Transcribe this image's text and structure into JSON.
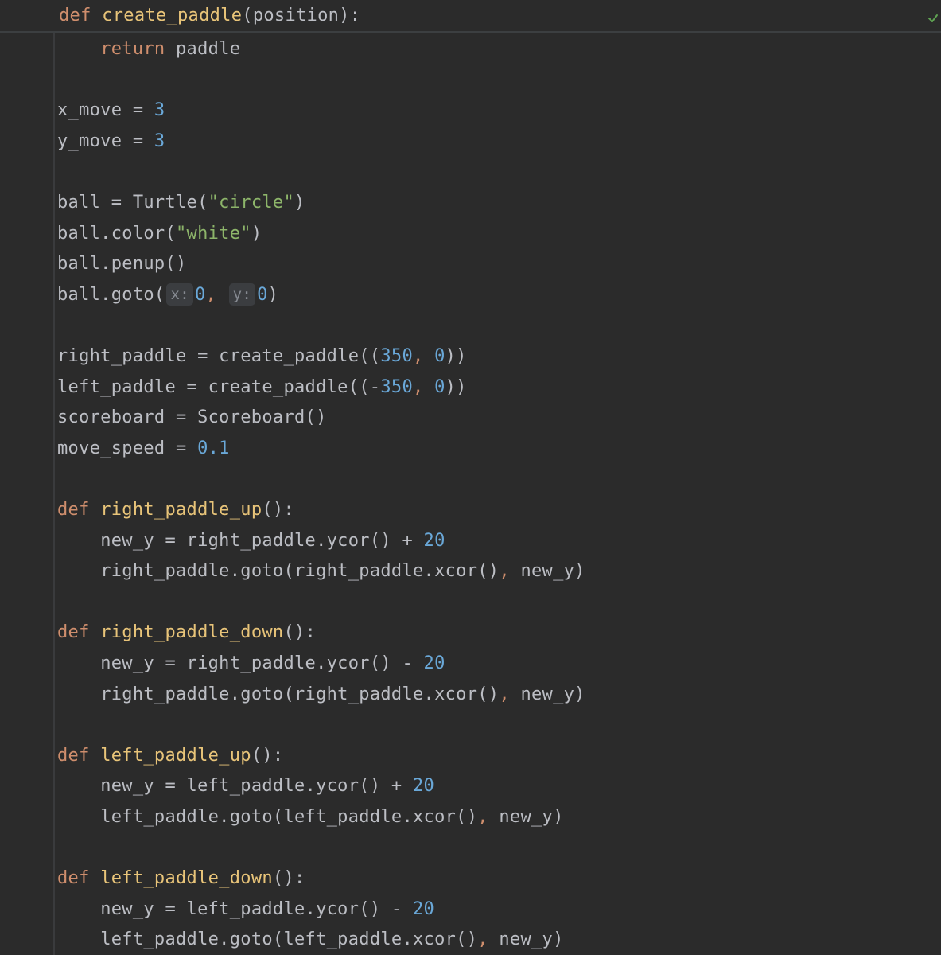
{
  "sticky": {
    "def": "def",
    "name": "create_paddle",
    "rest": "(position):"
  },
  "lines": [
    {
      "indent": "    ",
      "parts": [
        {
          "t": "return",
          "c": "kw"
        },
        {
          "t": " paddle"
        }
      ]
    },
    {
      "parts": []
    },
    {
      "parts": [
        {
          "t": "x_move = "
        },
        {
          "t": "3",
          "c": "num"
        }
      ]
    },
    {
      "parts": [
        {
          "t": "y_move = "
        },
        {
          "t": "3",
          "c": "num"
        }
      ]
    },
    {
      "parts": []
    },
    {
      "parts": [
        {
          "t": "ball = Turtle("
        },
        {
          "t": "\"circle\"",
          "c": "str"
        },
        {
          "t": ")"
        }
      ]
    },
    {
      "parts": [
        {
          "t": "ball.color("
        },
        {
          "t": "\"white\"",
          "c": "str"
        },
        {
          "t": ")"
        }
      ]
    },
    {
      "parts": [
        {
          "t": "ball.penup()"
        }
      ]
    },
    {
      "parts": [
        {
          "t": "ball.goto("
        },
        {
          "t": "x:",
          "c": "hint"
        },
        {
          "t": "0",
          "c": "num"
        },
        {
          "t": ", ",
          "c": "kw"
        },
        {
          "t": "y:",
          "c": "hint"
        },
        {
          "t": "0",
          "c": "num"
        },
        {
          "t": ")"
        }
      ]
    },
    {
      "parts": []
    },
    {
      "parts": [
        {
          "t": "right_paddle = create_paddle(("
        },
        {
          "t": "350",
          "c": "num"
        },
        {
          "t": ", ",
          "c": "kw"
        },
        {
          "t": "0",
          "c": "num"
        },
        {
          "t": "))"
        }
      ]
    },
    {
      "parts": [
        {
          "t": "left_paddle = create_paddle((-"
        },
        {
          "t": "350",
          "c": "num"
        },
        {
          "t": ", ",
          "c": "kw"
        },
        {
          "t": "0",
          "c": "num"
        },
        {
          "t": "))"
        }
      ]
    },
    {
      "parts": [
        {
          "t": "scoreboard = Scoreboard()"
        }
      ]
    },
    {
      "parts": [
        {
          "t": "move_speed = "
        },
        {
          "t": "0.1",
          "c": "num"
        }
      ]
    },
    {
      "parts": []
    },
    {
      "parts": [
        {
          "t": "def",
          "c": "kw"
        },
        {
          "t": " "
        },
        {
          "t": "right_paddle_up",
          "c": "fn"
        },
        {
          "t": "():"
        }
      ]
    },
    {
      "indent": "    ",
      "parts": [
        {
          "t": "new_y = right_paddle.ycor() + "
        },
        {
          "t": "20",
          "c": "num"
        }
      ]
    },
    {
      "indent": "    ",
      "parts": [
        {
          "t": "right_paddle.goto(right_paddle.xcor()"
        },
        {
          "t": ", ",
          "c": "kw"
        },
        {
          "t": "new_y)"
        }
      ]
    },
    {
      "parts": []
    },
    {
      "parts": [
        {
          "t": "def",
          "c": "kw"
        },
        {
          "t": " "
        },
        {
          "t": "right_paddle_down",
          "c": "fn"
        },
        {
          "t": "():"
        }
      ]
    },
    {
      "indent": "    ",
      "parts": [
        {
          "t": "new_y = right_paddle.ycor() - "
        },
        {
          "t": "20",
          "c": "num"
        }
      ]
    },
    {
      "indent": "    ",
      "parts": [
        {
          "t": "right_paddle.goto(right_paddle.xcor()"
        },
        {
          "t": ", ",
          "c": "kw"
        },
        {
          "t": "new_y)"
        }
      ]
    },
    {
      "parts": []
    },
    {
      "parts": [
        {
          "t": "def",
          "c": "kw"
        },
        {
          "t": " "
        },
        {
          "t": "left_paddle_up",
          "c": "fn"
        },
        {
          "t": "():"
        }
      ]
    },
    {
      "indent": "    ",
      "parts": [
        {
          "t": "new_y = left_paddle.ycor() + "
        },
        {
          "t": "20",
          "c": "num"
        }
      ]
    },
    {
      "indent": "    ",
      "parts": [
        {
          "t": "left_paddle.goto(left_paddle.xcor()"
        },
        {
          "t": ", ",
          "c": "kw"
        },
        {
          "t": "new_y)"
        }
      ]
    },
    {
      "parts": []
    },
    {
      "parts": [
        {
          "t": "def",
          "c": "kw"
        },
        {
          "t": " "
        },
        {
          "t": "left_paddle_down",
          "c": "fn"
        },
        {
          "t": "():"
        }
      ]
    },
    {
      "indent": "    ",
      "parts": [
        {
          "t": "new_y = left_paddle.ycor() - "
        },
        {
          "t": "20",
          "c": "num"
        }
      ]
    },
    {
      "indent": "    ",
      "parts": [
        {
          "t": "left_paddle.goto(left_paddle.xcor()"
        },
        {
          "t": ", ",
          "c": "kw"
        },
        {
          "t": "new_y)"
        }
      ]
    }
  ],
  "icons": {
    "status": "check-icon"
  },
  "colors": {
    "background": "#2b2b2b",
    "keyword": "#cf8e6d",
    "function": "#e8c479",
    "number": "#6aa8d8",
    "string": "#8db56a",
    "text": "#bcbec4",
    "check": "#5fa352"
  }
}
